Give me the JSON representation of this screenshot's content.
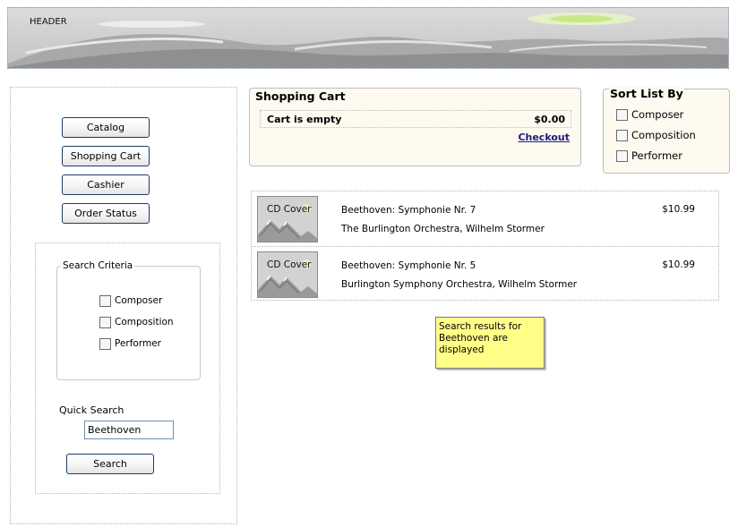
{
  "header": {
    "label": "HEADER"
  },
  "nav": {
    "items": [
      {
        "label": "Catalog"
      },
      {
        "label": "Shopping Cart"
      },
      {
        "label": "Cashier"
      },
      {
        "label": "Order Status"
      }
    ]
  },
  "search": {
    "criteria_title": "Search Criteria",
    "options": [
      {
        "label": "Composer",
        "checked": false
      },
      {
        "label": "Composition",
        "checked": false
      },
      {
        "label": "Performer",
        "checked": false
      }
    ],
    "quick_label": "Quick Search",
    "quick_value": "Beethoven",
    "button_label": "Search"
  },
  "cart": {
    "title": "Shopping Cart",
    "status": "Cart is empty",
    "total": "$0.00",
    "checkout_label": "Checkout"
  },
  "sort": {
    "title": "Sort List By",
    "options": [
      {
        "label": "Composer",
        "checked": false
      },
      {
        "label": "Composition",
        "checked": false
      },
      {
        "label": "Performer",
        "checked": false
      }
    ]
  },
  "results": [
    {
      "cover_label": "CD Cover",
      "title": "Beethoven: Symphonie Nr. 7",
      "artist": "The Burlington Orchestra, Wilhelm Stormer",
      "price": "$10.99"
    },
    {
      "cover_label": "CD Cover",
      "title": "Beethoven: Symphonie Nr. 5",
      "artist": "Burlington Symphony Orchestra, Wilhelm Stormer",
      "price": "$10.99"
    }
  ],
  "note": {
    "text": "Search results for Beethoven are displayed"
  },
  "colors": {
    "panel_bg": "#fffaf0",
    "note_bg": "#ffff88",
    "link": "#1a1a80",
    "button_border": "#1e3c66"
  }
}
